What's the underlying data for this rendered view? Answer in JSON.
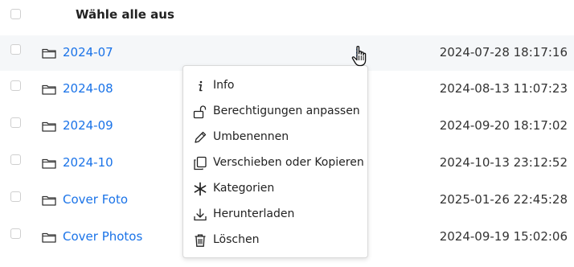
{
  "header": {
    "select_all_label": "Wähle alle aus"
  },
  "rows": [
    {
      "name": "2024-07",
      "timestamp": "2024-07-28 18:17:16"
    },
    {
      "name": "2024-08",
      "timestamp": "2024-08-13 11:07:23"
    },
    {
      "name": "2024-09",
      "timestamp": "2024-09-20 18:17:02"
    },
    {
      "name": "2024-10",
      "timestamp": "2024-10-13 23:12:52"
    },
    {
      "name": "Cover Foto",
      "timestamp": "2025-01-26 22:45:28"
    },
    {
      "name": "Cover Photos",
      "timestamp": "2024-09-19 15:02:06"
    }
  ],
  "context_menu": {
    "items": [
      {
        "label": "Info",
        "icon": "info-icon"
      },
      {
        "label": "Berechtigungen anpassen",
        "icon": "unlock-icon"
      },
      {
        "label": "Umbenennen",
        "icon": "pencil-icon"
      },
      {
        "label": "Verschieben oder Kopieren",
        "icon": "copy-icon"
      },
      {
        "label": "Kategorien",
        "icon": "asterisk-icon"
      },
      {
        "label": "Herunterladen",
        "icon": "download-icon"
      },
      {
        "label": "Löschen",
        "icon": "trash-icon"
      }
    ]
  },
  "colors": {
    "link": "#1a73e8",
    "hover_row": "#f5f7f9",
    "text": "#222222"
  }
}
